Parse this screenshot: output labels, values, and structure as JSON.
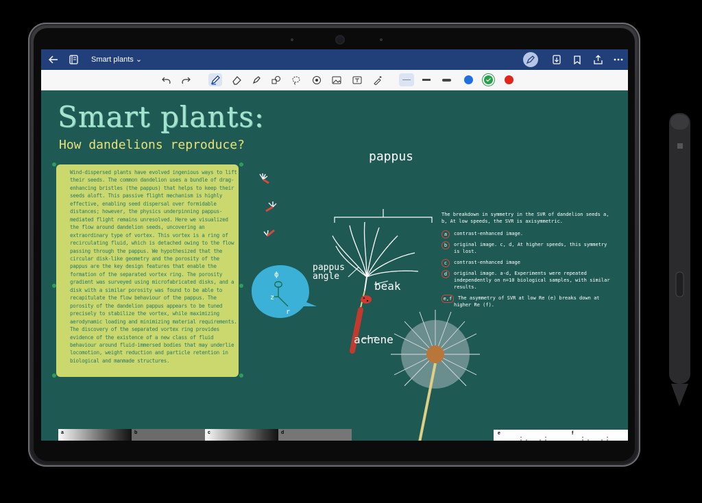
{
  "app": {
    "title": "Smart plants",
    "chevron": "⌄",
    "topbar_icons_left": [
      "back-arrow-icon",
      "notebook-icon"
    ],
    "topbar_icons_right": [
      "pen-sync-icon",
      "download-icon",
      "bookmark-icon",
      "share-icon",
      "more-icon"
    ]
  },
  "toolbar": {
    "tools": [
      "undo-icon",
      "redo-icon",
      "pen-icon",
      "eraser-icon",
      "highlighter-icon",
      "shapes-icon",
      "lasso-icon",
      "sticker-icon",
      "image-icon",
      "text-icon",
      "magic-pen-icon"
    ],
    "stroke_widths": [
      "thin",
      "medium",
      "thick"
    ],
    "colors": [
      "#1f6fe0",
      "#2aa04a",
      "#e1251b"
    ],
    "selected_color": "#2aa04a"
  },
  "page": {
    "heading": "Smart plants:",
    "subheading": "How dandelions reproduce?",
    "note_text": "Wind-dispersed plants have evolved ingenious ways to lift their seeds. The common dandelion uses a bundle of drag-enhancing bristles (the pappus) that helps to keep their seeds aloft. This passive flight mechanism is highly effective, enabling seed dispersal over formidable distances; however, the physics underpinning pappus-mediated flight remains unresolved. Here we visualized the flow around dandelion seeds, uncovering an extraordinary type of vortex. This vortex is a ring of recirculating fluid, which is detached owing to the flow passing through the pappus. We hypothesized that the circular disk-like geometry and the porosity of the pappus are the key design features that enable the formation of the separated vortex ring. The porosity gradient was surveyed using microfabricated disks, and a disk with a similar porosity was found to be able to recapitulate the flow behaviour of the pappus. The porosity of the dandelion pappus appears to be tuned precisely to stabilize the vortex, while maximizing aerodynamic loading and minimizing material requirements. The discovery of the separated vortex ring provides evidence of the existence of a new class of fluid behaviour around fluid-immersed bodies that may underlie locomotion, weight reduction and particle retention in biological and manmade structures.",
    "labels": {
      "pappus": "pappus",
      "pappus_angle": "pappus angle",
      "beak": "beak",
      "achene": "achene",
      "phi": "ϕ",
      "z": "z",
      "r": "r"
    },
    "notes_intro": "The breakdown in symmetry in the SVR of dandelion seeds a, b, At low speeds, the SVR is axisymmetric.",
    "notes": [
      {
        "bullet": "a",
        "text": "contrast-enhanced image."
      },
      {
        "bullet": "b",
        "text": "original image. c, d, At higher speeds, this symmetry is lost."
      },
      {
        "bullet": "c",
        "text": "contrast-enhanced image"
      },
      {
        "bullet": "d",
        "text": "original image. a-d, Experiments were repeated independently on n=10 biological samples, with similar results."
      },
      {
        "bullet": "e,f",
        "text": "The asymmetry of SVR at low Re (e) breaks down at higher Re (f)."
      }
    ],
    "photo_labels": [
      "a",
      "b",
      "c",
      "d"
    ],
    "figure_labels": [
      "e",
      "f"
    ]
  }
}
